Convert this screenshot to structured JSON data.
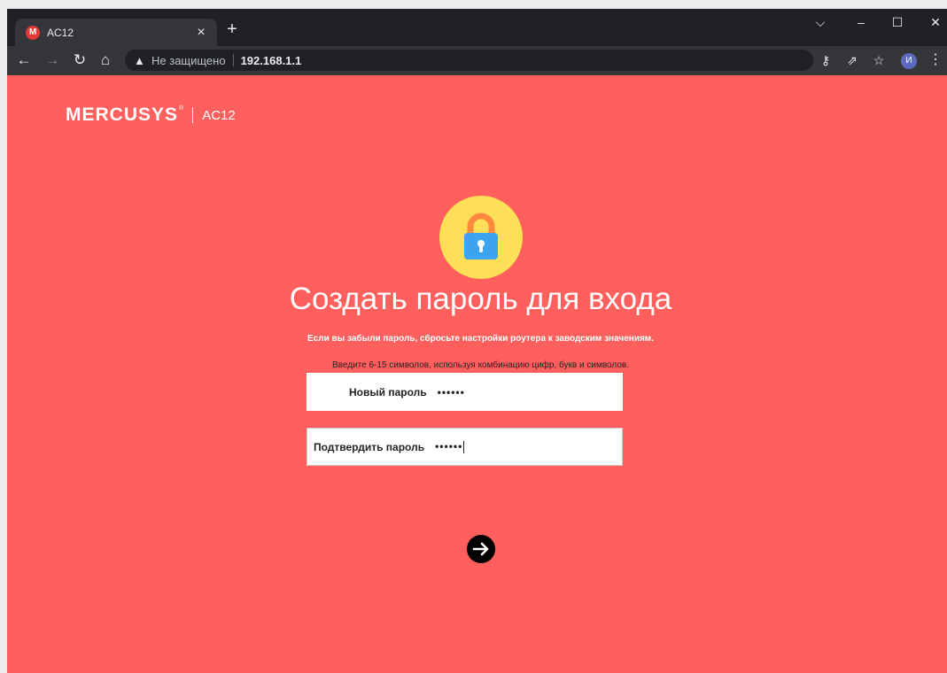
{
  "browser": {
    "tab": {
      "favicon_letter": "M",
      "title": "AC12"
    },
    "address": {
      "security_label": "Не защищено",
      "url": "192.168.1.1"
    },
    "avatar_letter": "И"
  },
  "header": {
    "brand": "MERCUSYS",
    "registered": "®",
    "model": "AC12"
  },
  "main": {
    "title": "Создать пароль для входа",
    "subtitle": "Если вы забыли пароль, сбросьте настройки роутера к заводским значениям.",
    "hint": "Введите 6-15 символов, используя комбинацию цифр, букв и символов.",
    "new_password": {
      "label": "Новый пароль",
      "value": "••••••"
    },
    "confirm_password": {
      "label": "Подтвердить пароль",
      "value": "••••••"
    }
  },
  "colors": {
    "page_bg": "#ff605d",
    "lock_circle": "#ffdf57",
    "lock_body": "#3ca3f0",
    "lock_shackle": "#ff8a3d"
  },
  "icons": [
    "back-arrow-icon",
    "forward-arrow-icon",
    "reload-icon",
    "home-icon",
    "warning-icon",
    "key-icon",
    "share-icon",
    "star-icon",
    "lock-icon",
    "arrow-right-icon"
  ]
}
